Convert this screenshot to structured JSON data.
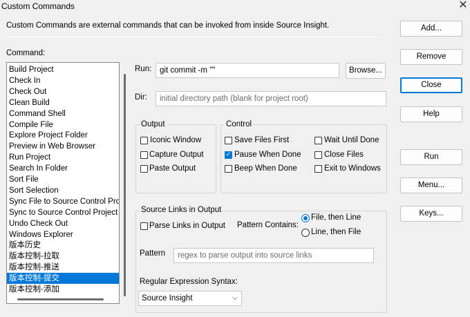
{
  "window": {
    "title": "Custom Commands",
    "close_glyph": "✕"
  },
  "description": "Custom Commands are external commands that can be invoked from inside Source Insight.",
  "command_label": "Command:",
  "commands": [
    "Build Project",
    "Check In",
    "Check Out",
    "Clean Build",
    "Command Shell",
    "Compile File",
    "Explore Project Folder",
    "Preview in Web Browser",
    "Run Project",
    "Search In Folder",
    "Sort File",
    "Sort Selection",
    "Sync File to Source Control Pro",
    "Sync to Source Control Project",
    "Undo Check Out",
    "Windows Explorer",
    "版本历史",
    "版本控制-拉取",
    "版本控制-推送",
    "版本控制-提交",
    "版本控制-添加"
  ],
  "selected_command": "版本控制-提交",
  "run": {
    "label": "Run:",
    "value": "git commit -m \"\"",
    "browse_label": "Browse..."
  },
  "dir": {
    "label": "Dir:",
    "placeholder": "initial directory path (blank for project root)"
  },
  "output_group": {
    "title": "Output",
    "options": [
      {
        "label": "Iconic Window",
        "checked": false
      },
      {
        "label": "Capture Output",
        "checked": false
      },
      {
        "label": "Paste Output",
        "checked": false
      }
    ]
  },
  "control_group": {
    "title": "Control",
    "options": [
      {
        "label": "Save Files First",
        "checked": false
      },
      {
        "label": "Wait Until Done",
        "checked": false
      },
      {
        "label": "Pause When Done",
        "checked": true
      },
      {
        "label": "Close Files",
        "checked": false
      },
      {
        "label": "Beep When Done",
        "checked": false
      },
      {
        "label": "Exit to Windows",
        "checked": false
      }
    ]
  },
  "source_links": {
    "title": "Source Links in Output",
    "parse_label": "Parse Links in Output",
    "parse_checked": false,
    "pattern_contains_label": "Pattern Contains:",
    "radio_file_line": "File, then Line",
    "radio_line_file": "Line, then File",
    "selected": "File, then Line",
    "pattern_label": "Pattern",
    "pattern_placeholder": "regex to parse output into source links",
    "syntax_label": "Regular Expression Syntax:",
    "syntax_value": "Source Insight"
  },
  "buttons": {
    "add": "Add...",
    "remove": "Remove",
    "close": "Close",
    "help": "Help",
    "run": "Run",
    "menu": "Menu...",
    "keys": "Keys..."
  },
  "colors": {
    "accent": "#0078d7",
    "selection": "#0078d7",
    "background": "#f0f0f0"
  }
}
